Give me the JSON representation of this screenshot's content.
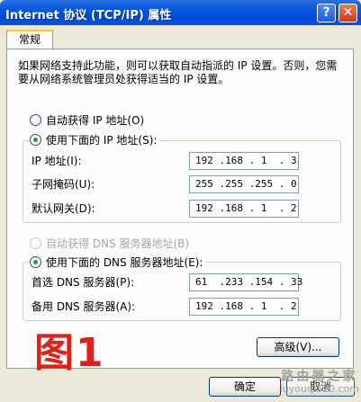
{
  "window": {
    "title": "Internet 协议 (TCP/IP) 属性",
    "help_glyph": "?",
    "close_glyph": "✕"
  },
  "tabs": [
    {
      "label": "常规"
    }
  ],
  "description": "如果网络支持此功能，则可以获取自动指派的 IP 设置。否则，您需要从网络系统管理员处获得适当的 IP 设置。",
  "ip_section": {
    "auto_label": "自动获得 IP 地址(O)",
    "manual_label": "使用下面的 IP 地址(S):",
    "fields": [
      {
        "label": "IP 地址(I):",
        "value": "192 .168 . 1  . 3"
      },
      {
        "label": "子网掩码(U):",
        "value": "255 .255 .255 . 0"
      },
      {
        "label": "默认网关(D):",
        "value": "192 .168 . 1  . 2"
      }
    ]
  },
  "dns_section": {
    "auto_label": "自动获得 DNS 服务器地址(B)",
    "manual_label": "使用下面的 DNS 服务器地址(E):",
    "fields": [
      {
        "label": "首选 DNS 服务器(P):",
        "value": "61  .233 .154 . 33"
      },
      {
        "label": "备用 DNS 服务器(A):",
        "value": "192 .168 . 1  . 2"
      }
    ]
  },
  "buttons": {
    "advanced": "高级(V)...",
    "ok": "确定",
    "cancel": "取消"
  },
  "annotation": "图1",
  "watermark": {
    "line1": "路由器之家",
    "line2": "luyouqi520.com"
  }
}
